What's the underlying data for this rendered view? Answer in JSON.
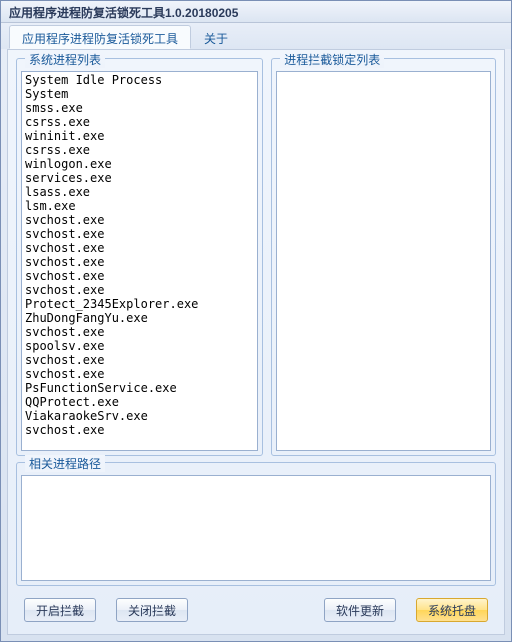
{
  "window": {
    "title": "应用程序进程防复活锁死工具1.0.20180205"
  },
  "tabs": {
    "main": "应用程序进程防复活锁死工具",
    "about": "关于"
  },
  "groups": {
    "process_list": "系统进程列表",
    "lock_list": "进程拦截锁定列表",
    "path": "相关进程路径"
  },
  "processes": [
    "System Idle Process",
    "System",
    "smss.exe",
    "csrss.exe",
    "wininit.exe",
    "csrss.exe",
    "winlogon.exe",
    "services.exe",
    "lsass.exe",
    "lsm.exe",
    "svchost.exe",
    "svchost.exe",
    "svchost.exe",
    "svchost.exe",
    "svchost.exe",
    "svchost.exe",
    "Protect_2345Explorer.exe",
    "ZhuDongFangYu.exe",
    "svchost.exe",
    "spoolsv.exe",
    "svchost.exe",
    "svchost.exe",
    "PsFunctionService.exe",
    "QQProtect.exe",
    "ViakaraokeSrv.exe",
    "svchost.exe"
  ],
  "buttons": {
    "start": "开启拦截",
    "stop": "关闭拦截",
    "update": "软件更新",
    "tray": "系统托盘"
  }
}
